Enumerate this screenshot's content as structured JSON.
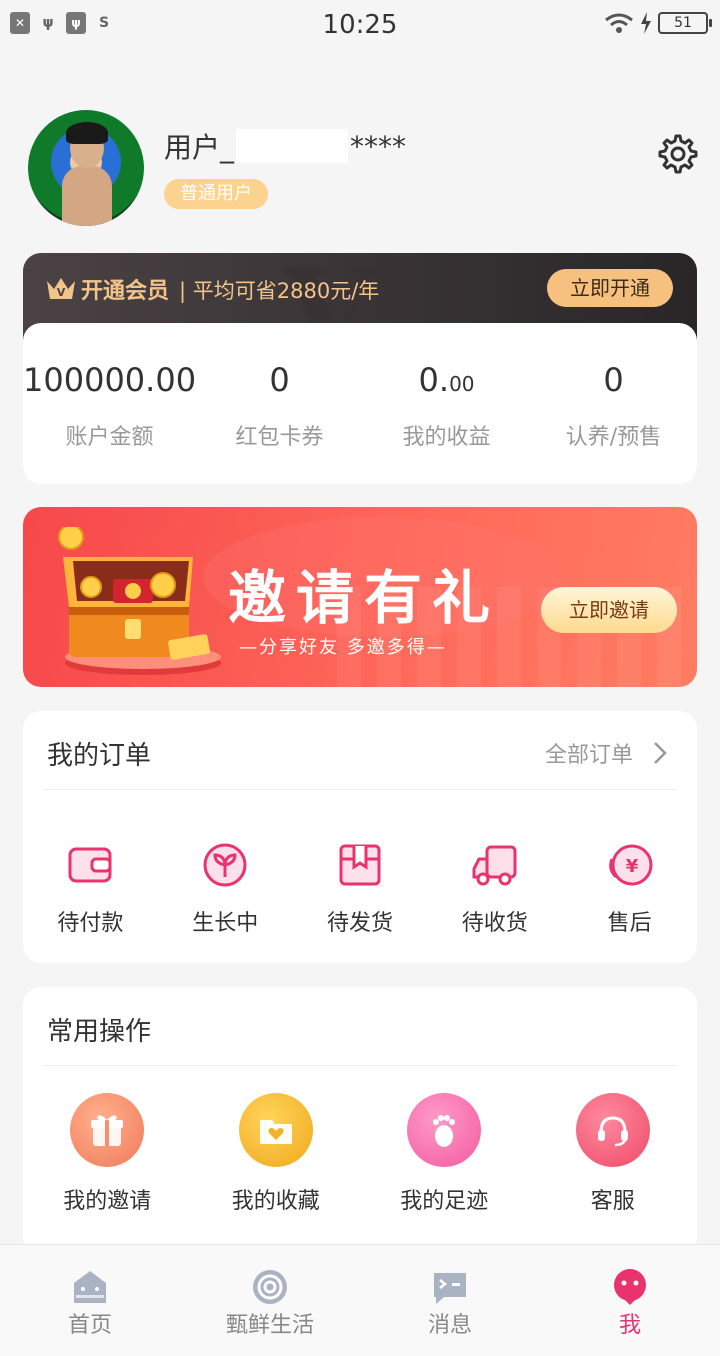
{
  "status_bar": {
    "time": "10:25",
    "battery": "51"
  },
  "profile": {
    "name_prefix": "用户_",
    "name_suffix": "****",
    "badge": "普通用户"
  },
  "member": {
    "title": "开通会员",
    "subtitle": "| 平均可省2880元/年",
    "button": "立即开通",
    "stats": [
      {
        "value": "100000.00",
        "label": "账户金额"
      },
      {
        "value": "0",
        "label": "红包卡券"
      },
      {
        "value_main": "0.",
        "value_small": "00",
        "label": "我的收益"
      },
      {
        "value": "0",
        "label": "认养/预售"
      }
    ]
  },
  "invite_banner": {
    "title": "邀请有礼",
    "subtitle": "—分享好友 多邀多得—",
    "button": "立即邀请"
  },
  "orders": {
    "title": "我的订单",
    "all_link": "全部订单",
    "items": [
      {
        "label": "待付款",
        "icon": "wallet-icon"
      },
      {
        "label": "生长中",
        "icon": "sprout-icon"
      },
      {
        "label": "待发货",
        "icon": "package-icon"
      },
      {
        "label": "待收货",
        "icon": "truck-icon"
      },
      {
        "label": "售后",
        "icon": "refund-icon"
      }
    ]
  },
  "common_ops": {
    "title": "常用操作",
    "items": [
      {
        "label": "我的邀请",
        "icon": "gift-icon"
      },
      {
        "label": "我的收藏",
        "icon": "folder-heart-icon"
      },
      {
        "label": "我的足迹",
        "icon": "footprint-icon"
      },
      {
        "label": "客服",
        "icon": "headset-icon"
      }
    ]
  },
  "tabbar": {
    "items": [
      {
        "label": "首页",
        "icon": "home-icon"
      },
      {
        "label": "甄鲜生活",
        "icon": "swirl-icon"
      },
      {
        "label": "消息",
        "icon": "message-icon"
      },
      {
        "label": "我",
        "icon": "profile-icon"
      }
    ],
    "active": "我"
  },
  "colors": {
    "accent": "#e8336f",
    "vip_gold": "#f2c48a",
    "banner_red": "#f6484b"
  }
}
